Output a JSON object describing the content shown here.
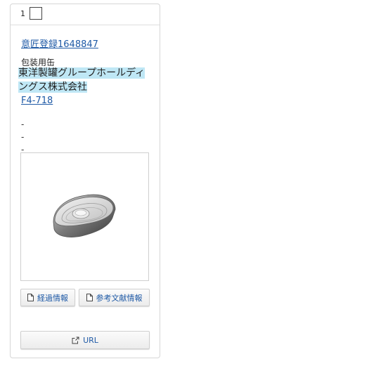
{
  "card": {
    "number": "1",
    "registration_link": "意匠登録1648847",
    "article": "包装用缶",
    "applicant": "東洋製罐グループホールディングス株式会社",
    "design_code": "F4-718",
    "dashes": [
      "-",
      "-",
      "-"
    ],
    "buttons": {
      "history": "経過情報",
      "references": "参考文献情報",
      "url": "URL"
    }
  },
  "colors": {
    "link": "#1f5aa6",
    "highlight": "#bfe7f5",
    "border": "#d6d6d6"
  },
  "icons": {
    "history": "document-icon",
    "references": "document-icon",
    "url": "external-link-icon"
  }
}
